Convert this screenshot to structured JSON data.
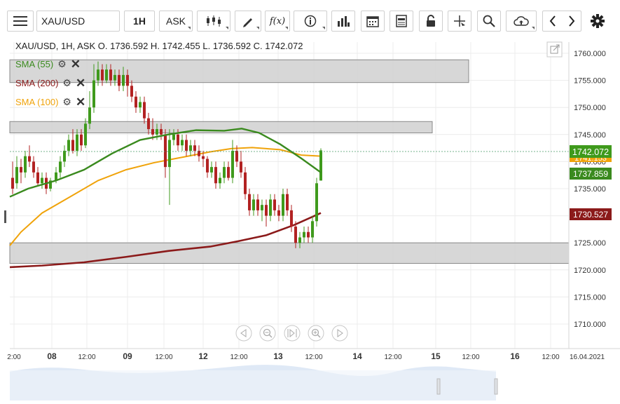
{
  "toolbar": {
    "symbol": "XAU/USD",
    "timeframe": "1H",
    "price_type": "ASK",
    "icons": [
      "menu-icon",
      "candles-icon",
      "draw-pencil-icon",
      "formula-icon",
      "info-icon",
      "bars-icon",
      "calendar-icon",
      "report-icon",
      "lock-icon",
      "crosshair-icon",
      "zoom-icon",
      "cloud-upload-icon",
      "arrow-left-icon",
      "arrow-right-icon",
      "gear-icon"
    ],
    "formula_label": "f(x)"
  },
  "header": {
    "ohlc": "XAU/USD, 1H, ASK   O. 1736.592 H. 1742.455 L. 1736.592 C. 1742.072"
  },
  "indicators": [
    {
      "label": "SMA (55)",
      "color": "#3a8a1e"
    },
    {
      "label": "SMA (200)",
      "color": "#8b1a1a"
    },
    {
      "label": "SMA (100)",
      "color": "#f0a30a"
    }
  ],
  "axis": {
    "y_ticks": [
      "1760.000",
      "1755.000",
      "1750.000",
      "1745.000",
      "1740.000",
      "1735.000",
      "1730.000",
      "1725.000",
      "1720.000",
      "1715.000",
      "1710.000"
    ],
    "x_ticks": [
      "2:00",
      "08",
      "12:00",
      "09",
      "12:00",
      "12",
      "12:00",
      "13",
      "12:00",
      "14",
      "12:00",
      "15",
      "12:00",
      "16",
      "12:00",
      "16.04.2021"
    ]
  },
  "badges": {
    "last_price": {
      "value": "1742.072",
      "color": "#3f9a1c"
    },
    "sma55": {
      "value": "1737.859",
      "color": "#3a8a1e"
    },
    "sma200": {
      "value": "1730.527",
      "color": "#8b1a1a"
    },
    "sma100_partial": "1741.153"
  },
  "colors": {
    "up": "#3f9a1c",
    "down": "#b22222",
    "grid": "#ececec",
    "zone_fill": "#d0d0d0",
    "zone_stroke": "#888888"
  },
  "zones_prices": [
    [
      1758.8,
      1754.6
    ],
    [
      1747.4,
      1745.3
    ],
    [
      1725.0,
      1721.2
    ]
  ],
  "nav_buttons": [
    "scroll-left-icon",
    "zoom-out-icon",
    "reset-icon",
    "zoom-in-icon",
    "scroll-right-icon"
  ]
}
